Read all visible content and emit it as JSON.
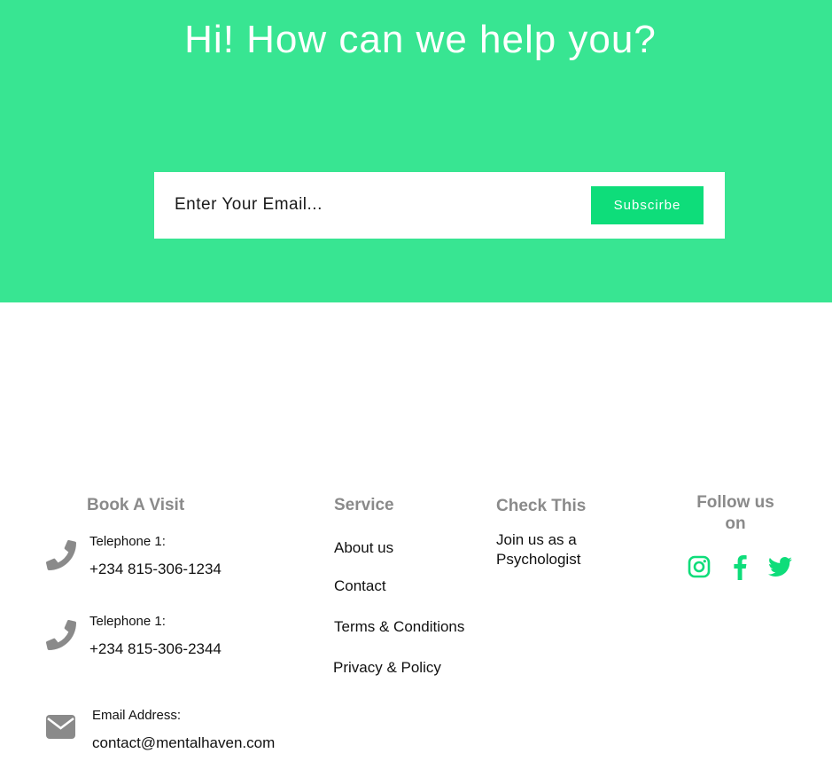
{
  "hero": {
    "title": "Hi! How can we help you?",
    "email_placeholder": "Enter Your Email...",
    "subscribe_label": "Subscirbe"
  },
  "colors": {
    "hero_bg": "#38e592",
    "button_bg": "#0edd7a",
    "heading_gray": "#8a8a8a",
    "icon_gray": "#8a8a8a",
    "social_green": "#0edd7a"
  },
  "footer": {
    "book": {
      "heading": "Book A Visit",
      "phone1": {
        "icon": "phone-icon",
        "label": "Telephone 1:",
        "value": "+234 815-306-1234"
      },
      "phone2": {
        "icon": "phone-icon",
        "label": "Telephone 1:",
        "value": "+234 815-306-2344"
      },
      "email": {
        "icon": "envelope-icon",
        "label": "Email Address:",
        "value": "contact@mentalhaven.com"
      }
    },
    "service": {
      "heading": "Service",
      "links": [
        "About us",
        "Contact",
        "Terms & Conditions",
        "Privacy & Policy"
      ]
    },
    "check": {
      "heading": "Check This",
      "line1": "Join us as a",
      "line2": "Psychologist"
    },
    "follow": {
      "heading_line1": "Follow us",
      "heading_line2": "on",
      "icons": [
        "instagram-icon",
        "facebook-icon",
        "twitter-icon"
      ]
    }
  }
}
